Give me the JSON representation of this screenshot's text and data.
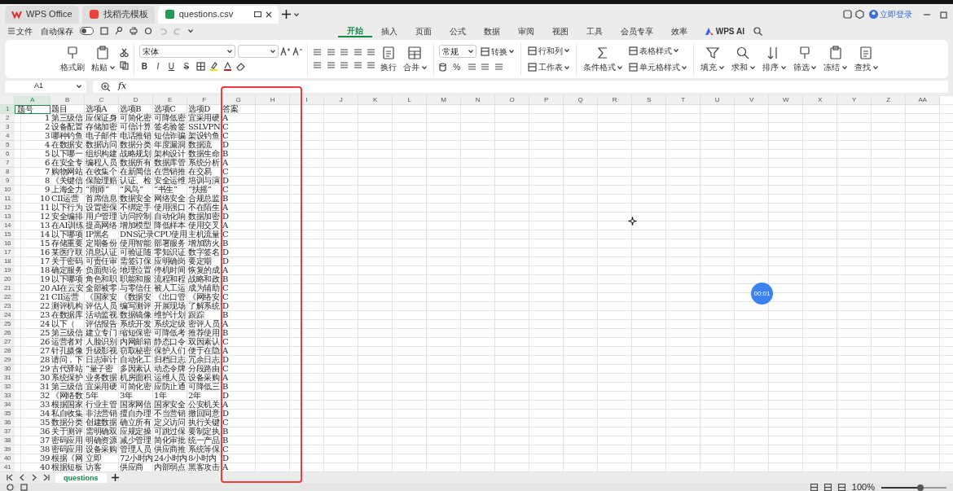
{
  "window_tabs": [
    {
      "label": "WPS Office",
      "kind": "home",
      "selected": false
    },
    {
      "label": "找稻壳模板",
      "kind": "template",
      "selected": false
    },
    {
      "label": "questions.csv",
      "kind": "sheet",
      "selected": true
    }
  ],
  "account": {
    "label": "立即登录"
  },
  "quick_bar": {
    "file_label": "文件",
    "autosave_label": "自动保存",
    "autosave_on": false
  },
  "ribbon_tabs": [
    {
      "label": "开始",
      "selected": true
    },
    {
      "label": "插入",
      "selected": false
    },
    {
      "label": "页面",
      "selected": false
    },
    {
      "label": "公式",
      "selected": false
    },
    {
      "label": "数据",
      "selected": false
    },
    {
      "label": "审阅",
      "selected": false
    },
    {
      "label": "视图",
      "selected": false
    },
    {
      "label": "工具",
      "selected": false
    },
    {
      "label": "会员专享",
      "selected": false
    },
    {
      "label": "效率",
      "selected": false
    },
    {
      "label": "WPS AI",
      "selected": false,
      "kind": "ai"
    }
  ],
  "ribbon_groups": [
    {
      "kind": "clipboard",
      "items": [
        {
          "label": "格式刷",
          "dropdown": false
        },
        {
          "label": "粘贴",
          "dropdown": true
        }
      ]
    },
    {
      "kind": "font",
      "font": "宋体",
      "glyphs": [
        "B",
        "I",
        "U",
        "S"
      ]
    },
    {
      "kind": "align",
      "items": [
        {
          "label": "换行",
          "dropdown": false
        },
        {
          "label": "合并",
          "dropdown": true
        }
      ]
    },
    {
      "kind": "number",
      "format": "常规",
      "small": [
        {
          "label": "转换",
          "dropdown": true
        }
      ],
      "glyphs": [
        "%"
      ]
    },
    {
      "kind": "smallstack",
      "small": [
        {
          "label": "行和列",
          "dropdown": true
        },
        {
          "label": "工作表",
          "dropdown": true
        }
      ]
    },
    {
      "kind": "style",
      "items": [
        {
          "label": "条件格式",
          "dropdown": true
        }
      ],
      "small": [
        {
          "label": "表格样式",
          "dropdown": true
        },
        {
          "label": "单元格样式",
          "dropdown": true
        }
      ]
    },
    {
      "kind": "edit",
      "items": [
        {
          "label": "填充",
          "dropdown": true
        },
        {
          "label": "求和",
          "dropdown": true
        },
        {
          "label": "排序",
          "dropdown": true
        },
        {
          "label": "筛选",
          "dropdown": true
        },
        {
          "label": "冻结",
          "dropdown": true
        },
        {
          "label": "查找",
          "dropdown": true
        }
      ]
    }
  ],
  "formula_bar": {
    "name_box": "A1",
    "fx": "fx"
  },
  "columns": [
    {
      "label": "A",
      "selected": true
    },
    {
      "label": "B",
      "selected": false
    },
    {
      "label": "C",
      "selected": false
    },
    {
      "label": "D",
      "selected": false
    },
    {
      "label": "E",
      "selected": false
    },
    {
      "label": "F",
      "selected": false
    },
    {
      "label": "G",
      "selected": false
    },
    {
      "label": "H",
      "selected": false
    },
    {
      "label": "I",
      "selected": false
    },
    {
      "label": "J",
      "selected": false
    },
    {
      "label": "K",
      "selected": false
    },
    {
      "label": "L",
      "selected": false
    },
    {
      "label": "M",
      "selected": false
    },
    {
      "label": "N",
      "selected": false
    },
    {
      "label": "O",
      "selected": false
    },
    {
      "label": "P",
      "selected": false
    },
    {
      "label": "Q",
      "selected": false
    },
    {
      "label": "R",
      "selected": false
    },
    {
      "label": "S",
      "selected": false
    },
    {
      "label": "T",
      "selected": false
    },
    {
      "label": "U",
      "selected": false
    },
    {
      "label": "V",
      "selected": false
    },
    {
      "label": "W",
      "selected": false
    },
    {
      "label": "X",
      "selected": false
    },
    {
      "label": "Y",
      "selected": false
    },
    {
      "label": "Z",
      "selected": false
    },
    {
      "label": "AA",
      "selected": false
    }
  ],
  "rows": [
    {
      "number": "1",
      "selected": true,
      "cells": [
        "题号",
        "题目",
        "选项A",
        "选项B",
        "选项C",
        "选项D",
        "答案"
      ]
    },
    {
      "number": "2",
      "selected": false,
      "cells": [
        "1",
        "第三级信",
        "应保证身",
        "可简化密",
        "可降低密",
        "宜采用硬",
        "A"
      ]
    },
    {
      "number": "3",
      "selected": false,
      "cells": [
        "2",
        "设备配置",
        "存储加密",
        "可信计算",
        "签名验签",
        "SSLVPN",
        "C"
      ]
    },
    {
      "number": "4",
      "selected": false,
      "cells": [
        "3",
        "哪种钓鱼",
        "电子邮件",
        "电话推销",
        "短信诈骗",
        "架设钓鱼",
        "C"
      ]
    },
    {
      "number": "5",
      "selected": false,
      "cells": [
        "4",
        "在数据安",
        "数据访问",
        "数据分类",
        "年度漏洞",
        "数据流",
        "D"
      ]
    },
    {
      "number": "6",
      "selected": false,
      "cells": [
        "5",
        "以下哪一",
        "组织构建",
        "战略规划",
        "架构设计",
        "数据生命",
        "B"
      ]
    },
    {
      "number": "7",
      "selected": false,
      "cells": [
        "6",
        "在安全专",
        "编程人员",
        "数据所有",
        "数据库管",
        "系统分析",
        "A"
      ]
    },
    {
      "number": "8",
      "selected": false,
      "cells": [
        "7",
        "购物网站",
        "在收集个",
        "在新闻信",
        "在营销推",
        "在交易",
        "C"
      ]
    },
    {
      "number": "9",
      "selected": false,
      "cells": [
        "8",
        "《关键信",
        "保险理赔",
        "认证、检",
        "安全运维",
        "培训与演",
        "D"
      ]
    },
    {
      "number": "10",
      "selected": false,
      "cells": [
        "9",
        "上海全力",
        "“雨师”",
        "“风鸟”",
        "“书生”",
        "“扶摇”",
        "C"
      ]
    },
    {
      "number": "11",
      "selected": false,
      "cells": [
        "10",
        "CII运营",
        "首席信息",
        "数据安全",
        "网络安全",
        "合规总监",
        "B"
      ]
    },
    {
      "number": "12",
      "selected": false,
      "cells": [
        "11",
        "以下行为",
        "设置密保",
        "不绑定手",
        "使用强口",
        "不在陌生",
        "A"
      ]
    },
    {
      "number": "13",
      "selected": false,
      "cells": [
        "12",
        "安全编排",
        "用户管理",
        "访问控制",
        "自动化响",
        "数据加密",
        "D"
      ]
    },
    {
      "number": "14",
      "selected": false,
      "cells": [
        "13",
        "在AI训练",
        "提高网络",
        "增加模型",
        "降低样本",
        "使用交叉",
        "A"
      ]
    },
    {
      "number": "15",
      "selected": false,
      "cells": [
        "14",
        "以下哪项",
        "IP黑名",
        "DNS记录",
        "CPU使用",
        "主机流量",
        "C"
      ]
    },
    {
      "number": "16",
      "selected": false,
      "cells": [
        "15",
        "存储重要",
        "定期备份",
        "使用智能",
        "部署服务",
        "增加防火",
        "B"
      ]
    },
    {
      "number": "17",
      "selected": false,
      "cells": [
        "16",
        "某医疗联",
        "消息认证",
        "可验证随",
        "零知识证",
        "数字签名",
        "D"
      ]
    },
    {
      "number": "18",
      "selected": false,
      "cells": [
        "17",
        "关于密码",
        "可责任审",
        "需签订保",
        "应明确岗",
        "要定期",
        "D"
      ]
    },
    {
      "number": "19",
      "selected": false,
      "cells": [
        "18",
        "确定服务",
        "负面舆论",
        "地理位置",
        "停机时间",
        "恢复的成",
        "A"
      ]
    },
    {
      "number": "20",
      "selected": false,
      "cells": [
        "19",
        "以下哪项",
        "角色和职",
        "职能和服",
        "流程和程",
        "战略和政",
        "B"
      ]
    },
    {
      "number": "21",
      "selected": false,
      "cells": [
        "20",
        "AI在云安",
        "全部被零",
        "与零信任",
        "被人工运",
        "成为辅助",
        "C"
      ]
    },
    {
      "number": "22",
      "selected": false,
      "cells": [
        "21",
        "CII运营",
        "《国家安",
        "《数据安",
        "《出口管",
        "《网络安",
        "C"
      ]
    },
    {
      "number": "23",
      "selected": false,
      "cells": [
        "22",
        "测评机构",
        "评估人员",
        "编写测评",
        "开展现场",
        "了解系统",
        "D"
      ]
    },
    {
      "number": "24",
      "selected": false,
      "cells": [
        "23",
        "在数据库",
        "活动监视",
        "数据镜像",
        "维护计划",
        "跟踪",
        "B"
      ]
    },
    {
      "number": "25",
      "selected": false,
      "cells": [
        "24",
        "以下（",
        "评估报告",
        "系统开发",
        "系统定级",
        "密评人员",
        "A"
      ]
    },
    {
      "number": "26",
      "selected": false,
      "cells": [
        "25",
        "第三级信",
        "建立专门",
        "缩短保密",
        "可降低考",
        "推荐使用",
        "B"
      ]
    },
    {
      "number": "27",
      "selected": false,
      "cells": [
        "26",
        "运营者对",
        "人脸识别",
        "内网邮箱",
        "静态口令",
        "双因素认",
        "C"
      ]
    },
    {
      "number": "28",
      "selected": false,
      "cells": [
        "27",
        "针孔摄像",
        "升级影视",
        "窃取秘密",
        "保护人们",
        "便于在隐",
        "A"
      ]
    },
    {
      "number": "29",
      "selected": false,
      "cells": [
        "28",
        "请问，下",
        "日志审计",
        "自动化工",
        "归档日志",
        "冗余日志",
        "D"
      ]
    },
    {
      "number": "30",
      "selected": false,
      "cells": [
        "29",
        "古代驿站",
        "“量子密",
        "多因素认",
        "动态令牌",
        "分段路由",
        "C"
      ]
    },
    {
      "number": "31",
      "selected": false,
      "cells": [
        "30",
        "系统保护",
        "业务数据",
        "机房面积",
        "运维人员",
        "设备采购",
        "A"
      ]
    },
    {
      "number": "32",
      "selected": false,
      "cells": [
        "31",
        "第三级信",
        "宜采用硬",
        "可简化密",
        "应防止通",
        "可降低三",
        "B"
      ]
    },
    {
      "number": "33",
      "selected": false,
      "cells": [
        "32",
        "《网络数",
        "5年",
        "3年",
        "1年",
        "2年",
        "D"
      ]
    },
    {
      "number": "34",
      "selected": false,
      "cells": [
        "33",
        "根据国家",
        "行业主管",
        "国家网信",
        "国家安全",
        "公安机关",
        "A"
      ]
    },
    {
      "number": "35",
      "selected": false,
      "cells": [
        "34",
        "私自收集",
        "非法营销",
        "擅自办理",
        "不当营销",
        "撤回同意",
        "D"
      ]
    },
    {
      "number": "36",
      "selected": false,
      "cells": [
        "35",
        "数据分类",
        "创建数据",
        "确立所有",
        "定义访问",
        "执行关键",
        "C"
      ]
    },
    {
      "number": "37",
      "selected": false,
      "cells": [
        "36",
        "关于测评",
        "需明确双",
        "应规定操",
        "可跳过保",
        "要制定执",
        "B"
      ]
    },
    {
      "number": "38",
      "selected": false,
      "cells": [
        "37",
        "密码应用",
        "明确资源",
        "减少管理",
        "简化审批",
        "统一产品",
        "B"
      ]
    },
    {
      "number": "39",
      "selected": false,
      "cells": [
        "38",
        "密码应用",
        "设备采购",
        "管理人员",
        "供应商推",
        "系统等保",
        "C"
      ]
    },
    {
      "number": "40",
      "selected": false,
      "cells": [
        "39",
        "根据《网",
        "立即",
        "72小时内",
        "24小时内",
        "8小时内",
        "D"
      ]
    },
    {
      "number": "41",
      "selected": false,
      "cells": [
        "40",
        "根据短板",
        "访客",
        "供应商",
        "内部弱点",
        "黑客攻击",
        "A"
      ]
    }
  ],
  "sheet_tabs": [
    {
      "label": "questions",
      "selected": true
    }
  ],
  "recorder_badge": "00:01",
  "status_bar": {
    "zoom": "100%",
    "zoom_slider": {
      "level": 0.6
    }
  }
}
